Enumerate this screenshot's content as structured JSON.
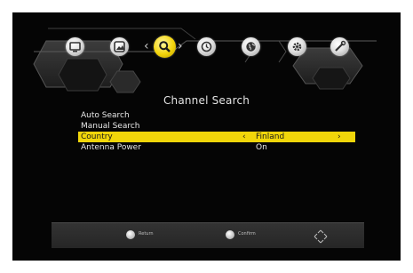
{
  "menu_bar": {
    "icons": [
      {
        "name": "tv-icon"
      },
      {
        "name": "picture-icon"
      },
      {
        "name": "search-icon",
        "active": true
      },
      {
        "name": "clock-icon"
      },
      {
        "name": "globe-icon"
      },
      {
        "name": "gear-icon"
      },
      {
        "name": "tools-icon"
      }
    ],
    "left_chevron": "‹",
    "right_chevron": "›",
    "accent_color": "#f1d60a"
  },
  "title": "Channel Search",
  "menu": {
    "items": [
      {
        "label": "Auto Search",
        "value": ""
      },
      {
        "label": "Manual Search",
        "value": ""
      },
      {
        "label": "Country",
        "value": "Finland",
        "selected": true
      },
      {
        "label": "Antenna Power",
        "value": "On"
      }
    ],
    "selected_left_arrow": "‹",
    "selected_right_arrow": "›"
  },
  "footer": {
    "return_label": "Return",
    "confirm_label": "Confirm"
  }
}
